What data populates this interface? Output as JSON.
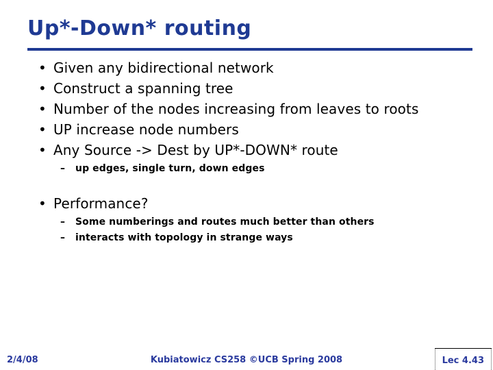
{
  "slide": {
    "title": "Up*-Down* routing",
    "accent_color": "#1F3A93",
    "body_color": "#000000",
    "footer_color": "#2A3A9E",
    "background_color": "#FFFFFF"
  },
  "bullets": [
    {
      "marker": "•",
      "text": "Given any bidirectional network"
    },
    {
      "marker": "•",
      "text": "Construct a spanning tree"
    },
    {
      "marker": "•",
      "text": "Number of the nodes increasing from leaves to roots"
    },
    {
      "marker": "•",
      "text": "UP increase node numbers"
    },
    {
      "marker": "•",
      "text": "Any Source -> Dest by UP*-DOWN* route"
    }
  ],
  "subbullets_a": [
    {
      "marker": "–",
      "text": "up edges, single turn, down edges"
    }
  ],
  "performance": {
    "marker": "•",
    "text": "Performance?"
  },
  "subbullets_b": [
    {
      "marker": "–",
      "text": "Some numberings and routes much better than others"
    },
    {
      "marker": "–",
      "text": "interacts with topology in strange ways"
    }
  ],
  "footer": {
    "date": "2/4/08",
    "attribution": "Kubiatowicz CS258 ©UCB Spring 2008",
    "lecture": "Lec 4.43"
  }
}
